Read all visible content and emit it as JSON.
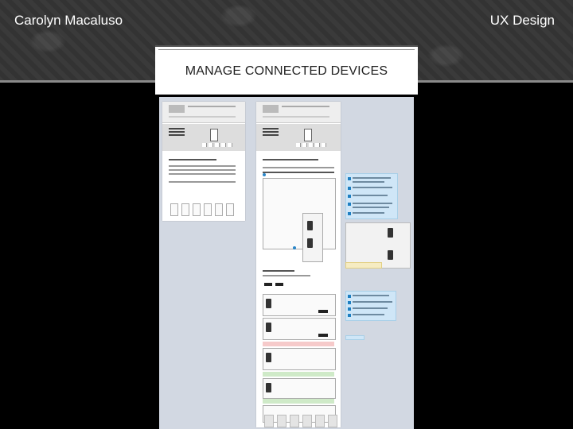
{
  "header": {
    "author": "Carolyn Macaluso",
    "topic": "UX Design"
  },
  "slide": {
    "title": "MANAGE CONNECTED DEVICES"
  },
  "colors": {
    "banner": "#383838",
    "canvas": "#d2d8e2",
    "note_blue": "#cfe6f7",
    "note_yellow": "#f6ecc2",
    "accent": "#2a86c8"
  }
}
